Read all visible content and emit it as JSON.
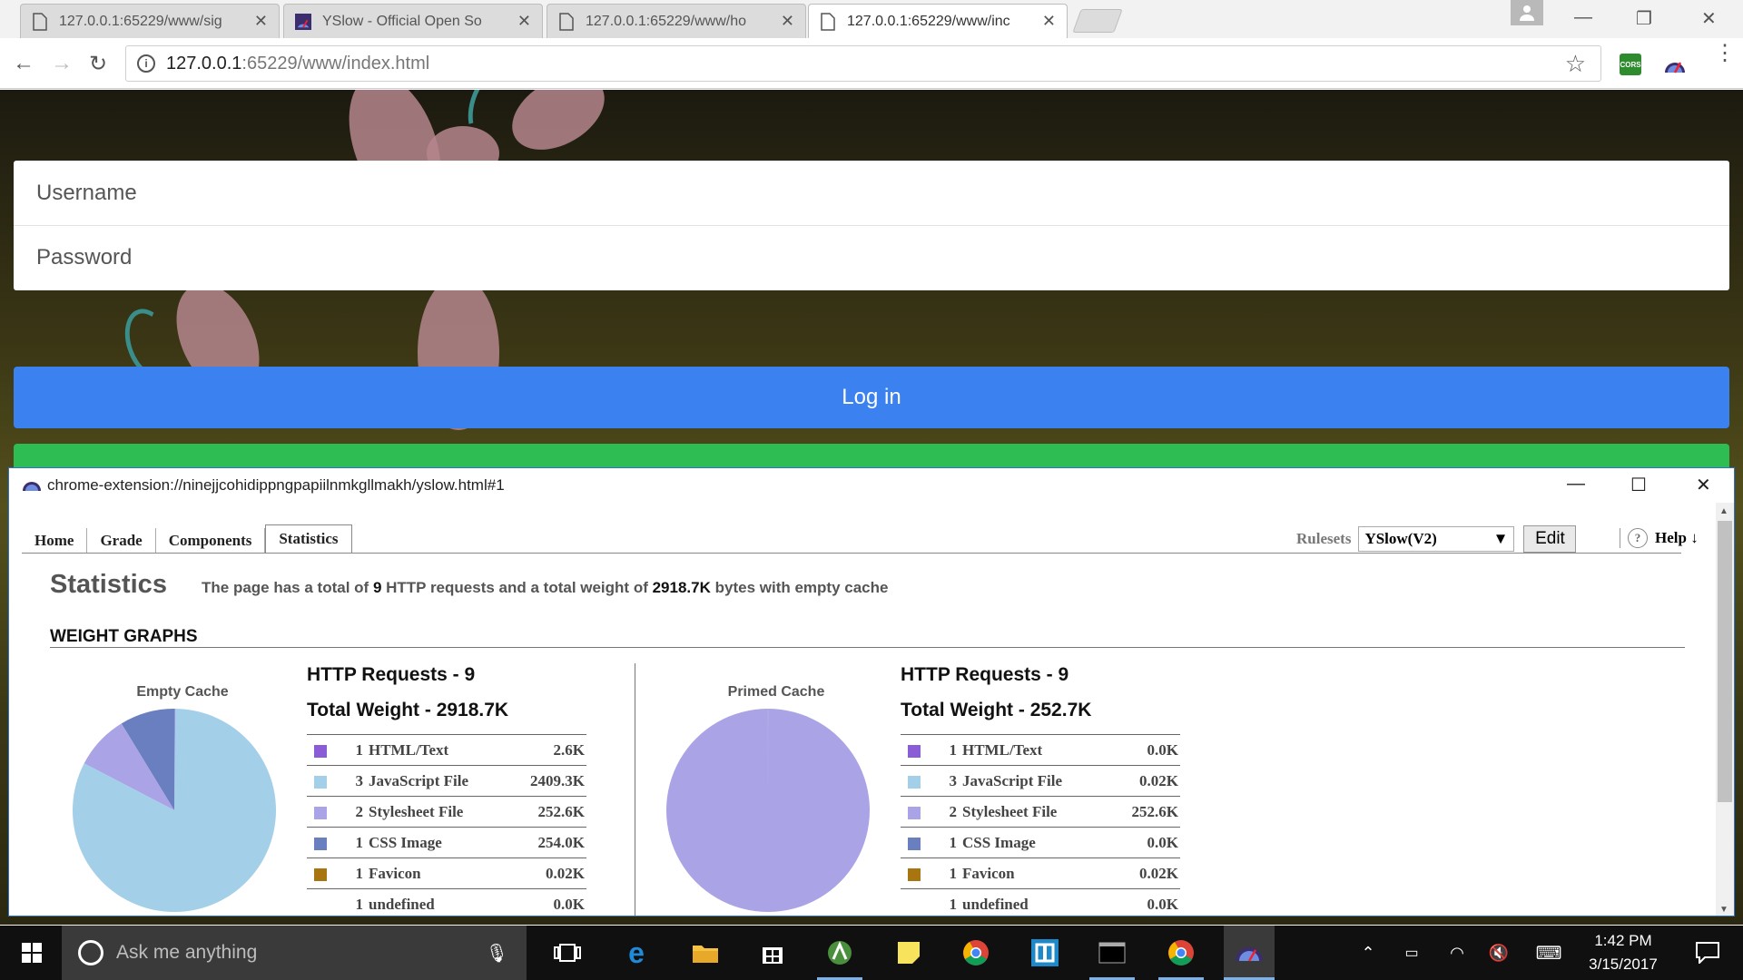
{
  "browser": {
    "tabs": [
      {
        "title": "127.0.0.1:65229/www/sig",
        "active": false
      },
      {
        "title": "YSlow - Official Open So",
        "active": false
      },
      {
        "title": "127.0.0.1:65229/www/ho",
        "active": false
      },
      {
        "title": "127.0.0.1:65229/www/inc",
        "active": true
      }
    ],
    "url_host": "127.0.0.1",
    "url_rest": ":65229/www/index.html",
    "extension_cors_label": "CORS"
  },
  "webpage": {
    "username_placeholder": "Username",
    "password_placeholder": "Password",
    "login_label": "Log in",
    "login_color": "#3b82f0",
    "secondary_color": "#2ebd53"
  },
  "yslow": {
    "window_title": "chrome-extension://ninejjcohidippngpapiilnmkgllmakh/yslow.html#1",
    "nav": [
      "Home",
      "Grade",
      "Components",
      "Statistics"
    ],
    "active_nav": "Statistics",
    "rulesets_label": "Rulesets",
    "ruleset_value": "YSlow(V2)",
    "edit_label": "Edit",
    "help_label": "Help ↓",
    "stats_title": "Statistics",
    "summary": {
      "prefix": "The page has a total of",
      "requests": "9",
      "middle": "HTTP requests and a total weight of",
      "weight": "2918.7K",
      "suffix": "bytes with empty cache"
    },
    "weight_graphs_heading": "WEIGHT GRAPHS",
    "empty_cache": {
      "label": "Empty Cache",
      "requests_line": "HTTP Requests - 9",
      "weight_line": "Total Weight - 2918.7K",
      "rows": [
        {
          "count": "1",
          "type": "HTML/Text",
          "size": "2.6K",
          "color": "#8a5cd6"
        },
        {
          "count": "3",
          "type": "JavaScript File",
          "size": "2409.3K",
          "color": "#a3d0e8"
        },
        {
          "count": "2",
          "type": "Stylesheet File",
          "size": "252.6K",
          "color": "#aaa3e6"
        },
        {
          "count": "1",
          "type": "CSS Image",
          "size": "254.0K",
          "color": "#6a7fbf"
        },
        {
          "count": "1",
          "type": "Favicon",
          "size": "0.02K",
          "color": "#a87510"
        },
        {
          "count": "1",
          "type": "undefined",
          "size": "0.0K",
          "color": ""
        }
      ]
    },
    "primed_cache": {
      "label": "Primed Cache",
      "requests_line": "HTTP Requests - 9",
      "weight_line": "Total Weight - 252.7K",
      "rows": [
        {
          "count": "1",
          "type": "HTML/Text",
          "size": "0.0K",
          "color": "#8a5cd6"
        },
        {
          "count": "3",
          "type": "JavaScript File",
          "size": "0.02K",
          "color": "#a3d0e8"
        },
        {
          "count": "2",
          "type": "Stylesheet File",
          "size": "252.6K",
          "color": "#aaa3e6"
        },
        {
          "count": "1",
          "type": "CSS Image",
          "size": "0.0K",
          "color": "#6a7fbf"
        },
        {
          "count": "1",
          "type": "Favicon",
          "size": "0.02K",
          "color": "#a87510"
        },
        {
          "count": "1",
          "type": "undefined",
          "size": "0.0K",
          "color": ""
        }
      ]
    }
  },
  "chart_data": [
    {
      "type": "pie",
      "title": "Empty Cache",
      "categories": [
        "HTML/Text",
        "JavaScript File",
        "Stylesheet File",
        "CSS Image",
        "Favicon",
        "undefined"
      ],
      "values": [
        2.6,
        2409.3,
        252.6,
        254.0,
        0.02,
        0.0
      ],
      "colors": [
        "#8a5cd6",
        "#a3d0e8",
        "#aaa3e6",
        "#6a7fbf",
        "#a87510",
        "#cccccc"
      ]
    },
    {
      "type": "pie",
      "title": "Primed Cache",
      "categories": [
        "HTML/Text",
        "JavaScript File",
        "Stylesheet File",
        "CSS Image",
        "Favicon",
        "undefined"
      ],
      "values": [
        0.0,
        0.02,
        252.6,
        0.0,
        0.02,
        0.0
      ],
      "colors": [
        "#8a5cd6",
        "#a3d0e8",
        "#aaa3e6",
        "#6a7fbf",
        "#a87510",
        "#cccccc"
      ]
    }
  ],
  "taskbar": {
    "search_placeholder": "Ask me anything",
    "time": "1:42 PM",
    "date": "3/15/2017"
  }
}
